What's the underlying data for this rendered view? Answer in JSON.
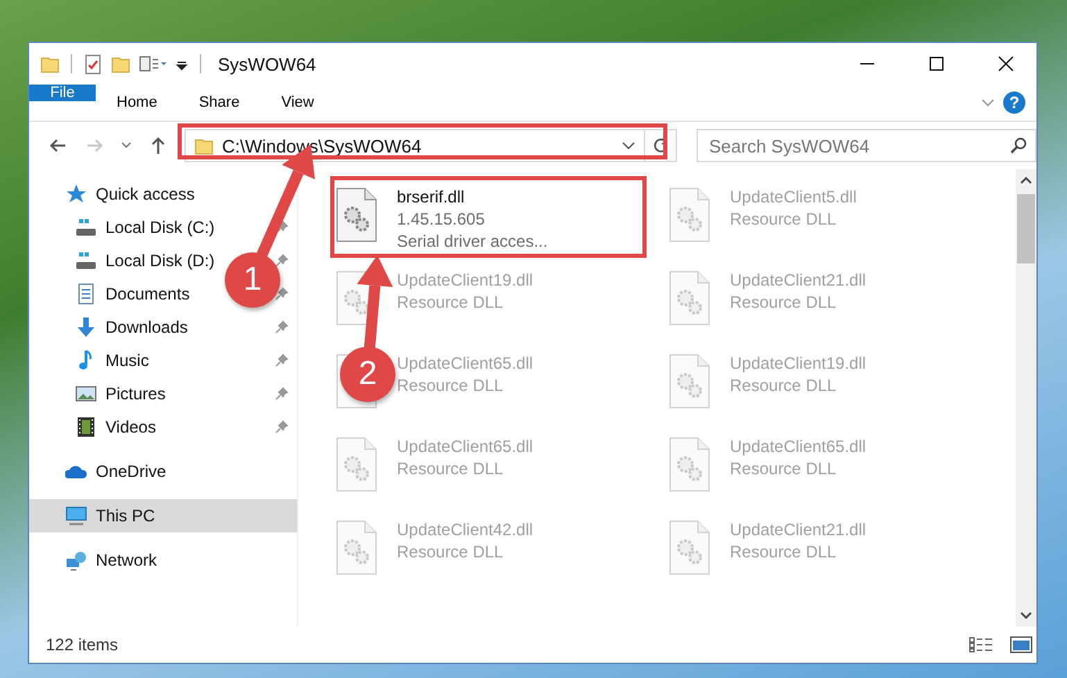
{
  "window": {
    "title": "SysWOW64"
  },
  "ribbon_tabs": [
    {
      "label": "File",
      "kind": "file"
    },
    {
      "label": "Home",
      "kind": "tab"
    },
    {
      "label": "Share",
      "kind": "tab"
    },
    {
      "label": "View",
      "kind": "tab"
    }
  ],
  "help": {
    "label": "?"
  },
  "address_bar": {
    "path": "C:\\Windows\\SysWOW64"
  },
  "search": {
    "placeholder": "Search SysWOW64"
  },
  "sidebar": {
    "items": [
      {
        "label": "Quick access",
        "kind": "star",
        "selected": false,
        "children": [
          {
            "label": "Local Disk (C:)",
            "kind": "drive",
            "pinned": true,
            "selected": false
          },
          {
            "label": "Local Disk (D:)",
            "kind": "drive",
            "pinned": true,
            "selected": false
          },
          {
            "label": "Documents",
            "kind": "documents",
            "pinned": true,
            "selected": false
          },
          {
            "label": "Downloads",
            "kind": "download",
            "pinned": true,
            "selected": false
          },
          {
            "label": "Music",
            "kind": "music",
            "pinned": true,
            "selected": false
          },
          {
            "label": "Pictures",
            "kind": "pictures",
            "pinned": true,
            "selected": false
          },
          {
            "label": "Videos",
            "kind": "videos",
            "pinned": true,
            "selected": false
          }
        ]
      },
      {
        "label": "OneDrive",
        "kind": "cloud",
        "selected": false
      },
      {
        "label": "This PC",
        "kind": "pc",
        "selected": true
      },
      {
        "label": "Network",
        "kind": "network",
        "selected": false
      }
    ]
  },
  "files": [
    {
      "name": "brserif.dll",
      "lines": [
        "1.45.15.605",
        "Serial driver acces..."
      ],
      "faded": false
    },
    {
      "name": "UpdateClient5.dll",
      "lines": [
        "Resource DLL"
      ],
      "faded": true
    },
    {
      "name": "UpdateClient19.dll",
      "lines": [
        "Resource DLL"
      ],
      "faded": true
    },
    {
      "name": "UpdateClient21.dll",
      "lines": [
        "Resource DLL"
      ],
      "faded": true
    },
    {
      "name": "UpdateClient65.dll",
      "lines": [
        "Resource DLL"
      ],
      "faded": true
    },
    {
      "name": "UpdateClient19.dll",
      "lines": [
        "Resource DLL"
      ],
      "faded": true
    },
    {
      "name": "UpdateClient65.dll",
      "lines": [
        "Resource DLL"
      ],
      "faded": true
    },
    {
      "name": "UpdateClient65.dll",
      "lines": [
        "Resource DLL"
      ],
      "faded": true
    },
    {
      "name": "UpdateClient42.dll",
      "lines": [
        "Resource DLL"
      ],
      "faded": true
    },
    {
      "name": "UpdateClient21.dll",
      "lines": [
        "Resource DLL"
      ],
      "faded": true
    }
  ],
  "status_bar": {
    "item_count": "122 items"
  },
  "annotations": [
    {
      "number": "1"
    },
    {
      "number": "2"
    }
  ]
}
